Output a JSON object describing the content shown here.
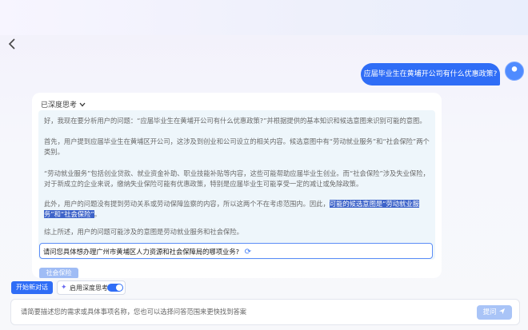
{
  "header": {
    "back_icon": "chevron-left-icon"
  },
  "user_message": "应届毕业生在黄埔开公司有什么优惠政策?",
  "answer": {
    "think_toggle_label": "已深度思考",
    "thinking": {
      "p1": "好，我现在要分析用户的问题：“应届毕业生在黄埔开公司有什么优惠政策?”并根据提供的基本知识和候选意图来识别可能的意图。",
      "p2": "首先，用户提到应届毕业生在黄埔区开公司，这涉及到创业和公司设立的相关内容。候选意图中有“劳动就业服务”和“社会保险”两个类别。",
      "p3": "“劳动就业服务”包括创业贷款、就业资金补助、职业技能补贴等内容，这些可能帮助应届毕业生创业。而“社会保险”涉及失业保险，对于新成立的企业来说，缴纳失业保险可能有优惠政策，特别是应届毕业生可能享受一定的减让或免除政策。",
      "p4_plain": "此外，用户的问题没有提到劳动关系或劳动保障监察的内容，所以这两个不在考虑范围内。因此，",
      "p4_highlight": "可能的候选意图是“劳动就业服务”和“社会保险”",
      "p4_end": "。",
      "p5": "综上所述，用户的问题可能涉及的意图是劳动就业服务和社会保险。"
    },
    "suggestion": "请问您具体想办理广州市黄埔区人力资源和社会保障局的哪项业务?",
    "tag": "社会保险"
  },
  "toolbar": {
    "new_chat": "开始新对话",
    "deep_think_label": "启用深度思考",
    "deep_think_on": true
  },
  "input": {
    "placeholder": "请简要描述您的需求或具体事项名称，您也可以选择问答范围来更快找到答案",
    "send": "提问"
  },
  "colors": {
    "accent": "#2f6df6",
    "highlight": "#3d63c9",
    "think_bg": "#eef6fb"
  }
}
